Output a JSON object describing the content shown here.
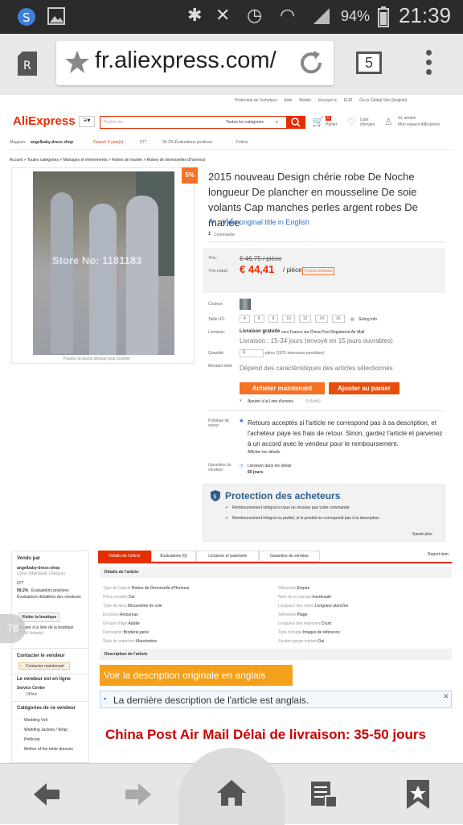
{
  "status": {
    "wifi_percent": "94%",
    "time": "21:39"
  },
  "browser": {
    "url": "fr.aliexpress.com/",
    "tab_count": "5"
  },
  "topnav": {
    "items": [
      "Protection de l'acheteur",
      "Aide",
      "Mobile",
      "Envoyer à",
      "EUR",
      "Go to Global Site (English)"
    ]
  },
  "header": {
    "logo": "AliExpress",
    "search_placeholder": "Recherche",
    "category": "Toutes les catégories",
    "cart_label": "Panier",
    "cart_count": "0",
    "wish_label": "Liste d'envies",
    "wish_count": "0",
    "account_label": "Hi, amelie",
    "account_sub": "Mon espace AliExpress"
  },
  "store": {
    "label": "Magasin:",
    "name": "angelbaby-dress shop",
    "open": "Ouvert: 3 year(s)",
    "score": "677",
    "positive": "99.2% Évaluations positives",
    "follow": "Follow"
  },
  "breadcrumb": "Accueil > Toutes catégories > Mariages et évènements > Robes de mariée > Robes de demoiselles d'honneur",
  "product": {
    "discount": "5%",
    "watermark": "Store No: 1181183",
    "zoom_hint": "Passez la souris dessus pour zoomer",
    "title": "2015 nouveau Design chérie robe De Noche longueur De plancher en mousseline De soie volants Cap manches perles argent robes De mariée",
    "view_original": "View original title in English",
    "orders": "1",
    "orders_label": "Commande"
  },
  "price": {
    "old_label": "Prix:",
    "old_value": "€ 46,75 / pièce",
    "label": "Prix réduit:",
    "value": "€ 44,41",
    "unit": "/ pièce",
    "badge": "5 jours restants"
  },
  "options": {
    "color_label": "Couleur:",
    "size_label": "Taille US:",
    "sizes": [
      "4",
      "6",
      "8",
      "10",
      "12",
      "14",
      "16"
    ],
    "size_info": "Sizing info",
    "shipping_label": "Livraison:",
    "shipping": "Livraison gratuite",
    "shipping_detail": "vers France via China Post Registered Air Mail",
    "delivery": "Livraison : 15-34 jours (envoyé en 15 jours ouvrables)",
    "qty_label": "Quantité:",
    "qty": "1",
    "qty_info": "pièce (1975 morceaux possibles)",
    "total_label": "Montant total:",
    "total": "Dépend des caractéristiques des articles sélectionnés",
    "buy": "Acheter maintenant",
    "cart": "Ajouter au panier",
    "wishlist": "Ajouter à la Liste d'envies",
    "wish_count": "(9 Adds)"
  },
  "returns": {
    "label": "Politique de retour:",
    "text": "Retours acceptés si l'article ne correspond pas à sa description, et l'acheteur paye les frais de retour. Sinon, gardez l'article et parvenez à un accord avec le vendeur pour le remboursement.",
    "more": "Afficher les détails",
    "guarantee_label": "Garanties du vendeur:",
    "guarantee": "Livraison dans les délais",
    "guarantee_days": "60 jours"
  },
  "protection": {
    "title": "Protection des acheteurs",
    "items": [
      "Remboursement intégral si vous ne recevez pas votre commande",
      "Remboursement intégral ou partiel, si le produit ne correspond pas à la description"
    ],
    "more": "Savoir plus"
  },
  "sidebar": {
    "sold_by": "Vendu par",
    "seller": "angelbaby-dress-shop",
    "country": "China (Mainland) (Jiangsu)",
    "score": "677",
    "positive": "99.2%",
    "positive_label": "Évaluations positives",
    "detail": "Évaluations détaillées des vendeurs",
    "visit": "Visiter la boutique",
    "follow": "Ajouter à la liste de la boutique",
    "follow_count": "(1256 Adepts)",
    "contact_title": "Contacter le vendeur",
    "contact_btn": "Contacter maintenant",
    "online_title": "Le vendeur est en ligne",
    "service": "Service Center",
    "offline": "Offline",
    "cat_title": "Catégories de ce vendeur",
    "cats": [
      "Wedding Veil",
      "Wedding Jackets / Wrap",
      "Petticoat",
      "Mother of the bride dresses"
    ],
    "bubble": "78"
  },
  "tabs": {
    "items": [
      "Détails de l'article",
      "Évaluations (0)",
      "Livraison et paiement",
      "Garanties du vendeur"
    ],
    "report": "Report item"
  },
  "details": {
    "title": "Détails de l'article",
    "left": [
      [
        "Type de l'article:",
        "Robes de Demoiselle d'Honneur"
      ],
      [
        "Pièce modèle:",
        "Oui"
      ],
      [
        "Type de tissu:",
        "Mousseline de soie"
      ],
      [
        "Encolure:",
        "Amoureux"
      ],
      [
        "Groupe d'âge:",
        "Adulte"
      ],
      [
        "Décoration:",
        "Broderie,perle"
      ],
      [
        "Style de manches:",
        "Manchettes"
      ]
    ],
    "right": [
      [
        "Silhouette:",
        "Empire"
      ],
      [
        "Nom de la marque:",
        "handmade"
      ],
      [
        "Longueur des robes:",
        "Longueur plancher"
      ],
      [
        "Silhouette:",
        "Plage"
      ],
      [
        "Longueur des manches:",
        "Court"
      ],
      [
        "Type d'image:",
        "Images de référence"
      ],
      [
        "Soutien-gorge intégré:",
        "Oui"
      ]
    ]
  },
  "description": {
    "title": "Description de l'article",
    "orig_btn": "Voir la description originale en anglais",
    "notice": "La dernière description de l'article est anglais.",
    "headline": "China Post Air Mail Délai de livraison: 35-50 jours"
  }
}
